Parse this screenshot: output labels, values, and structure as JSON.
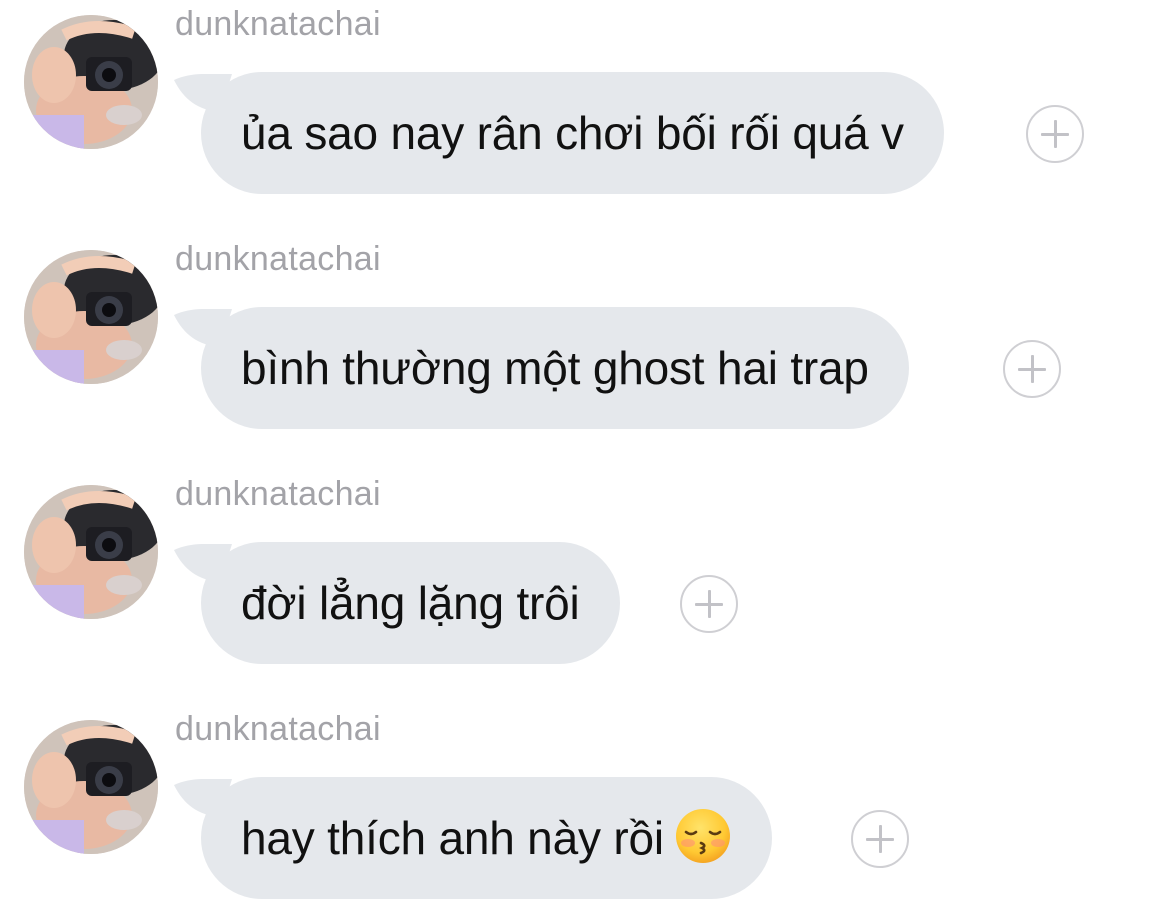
{
  "messages": [
    {
      "sender": "dunknatachai",
      "text": "ủa sao nay rân chơi bối rối quá v",
      "emoji": ""
    },
    {
      "sender": "dunknatachai",
      "text": "bình thường một ghost hai trap",
      "emoji": ""
    },
    {
      "sender": "dunknatachai",
      "text": "đời lẳng lặng trôi",
      "emoji": ""
    },
    {
      "sender": "dunknatachai",
      "text": "hay thích anh này rồi",
      "emoji": "kissing-face-closed-eyes"
    }
  ],
  "colors": {
    "bubble": "#e5e8ec",
    "text": "#111111",
    "sender": "#a3a3a8",
    "react_border": "#cfcfd3"
  },
  "icons": {
    "avatar": "avatar-photo-camera",
    "react": "add-reaction-plus-icon"
  }
}
